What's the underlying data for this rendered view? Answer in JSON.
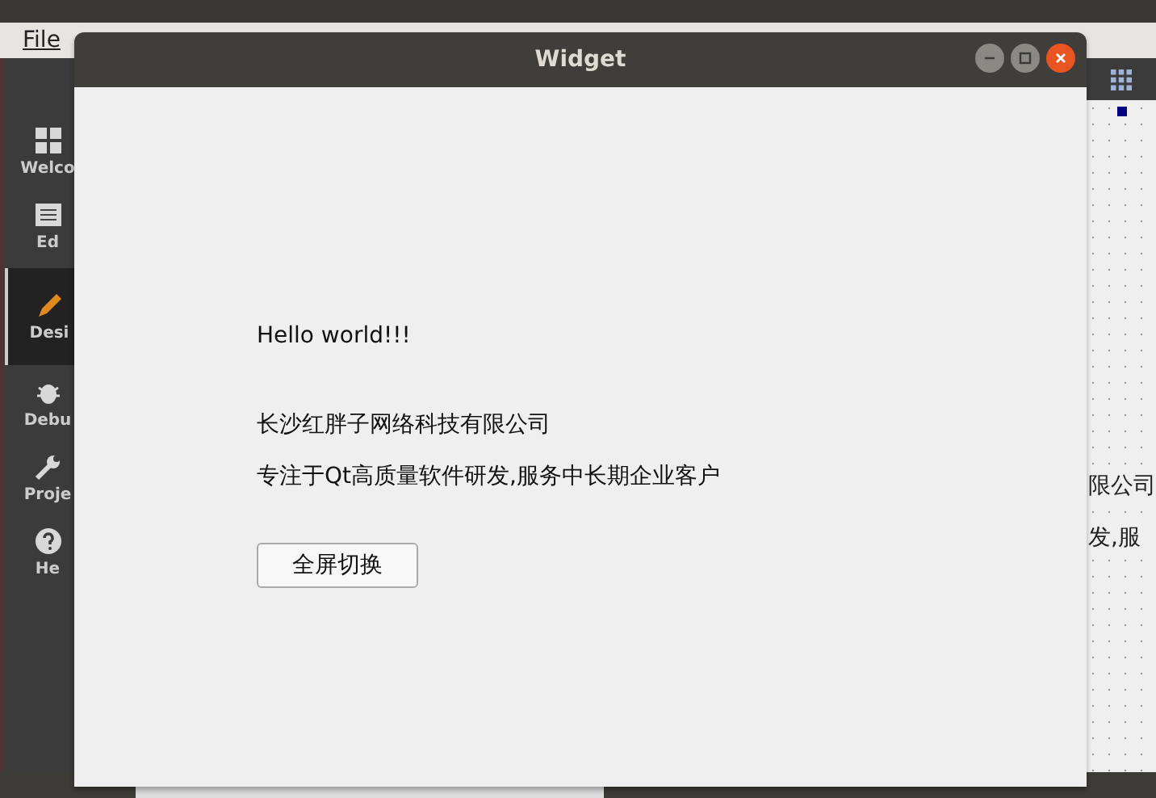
{
  "menu_bar": {
    "items": [
      "File"
    ]
  },
  "sidebar": {
    "items": [
      {
        "label": "Welco",
        "kind": "grid",
        "selected": false
      },
      {
        "label": "Ed",
        "kind": "doc",
        "selected": false
      },
      {
        "label": "Desi",
        "kind": "pencil",
        "selected": true
      },
      {
        "label": "Debu",
        "kind": "bug",
        "selected": false
      },
      {
        "label": "Proje",
        "kind": "wrench",
        "selected": false
      },
      {
        "label": "He",
        "kind": "help",
        "selected": false
      }
    ]
  },
  "canvas": {
    "texts": [
      "限公司",
      "发,服"
    ]
  },
  "window": {
    "title": "Widget",
    "texts": [
      "Hello world!!!",
      "长沙红胖子网络科技有限公司",
      "专注于Qt高质量软件研发,服务中长期企业客户"
    ],
    "button": "全屏切换"
  }
}
